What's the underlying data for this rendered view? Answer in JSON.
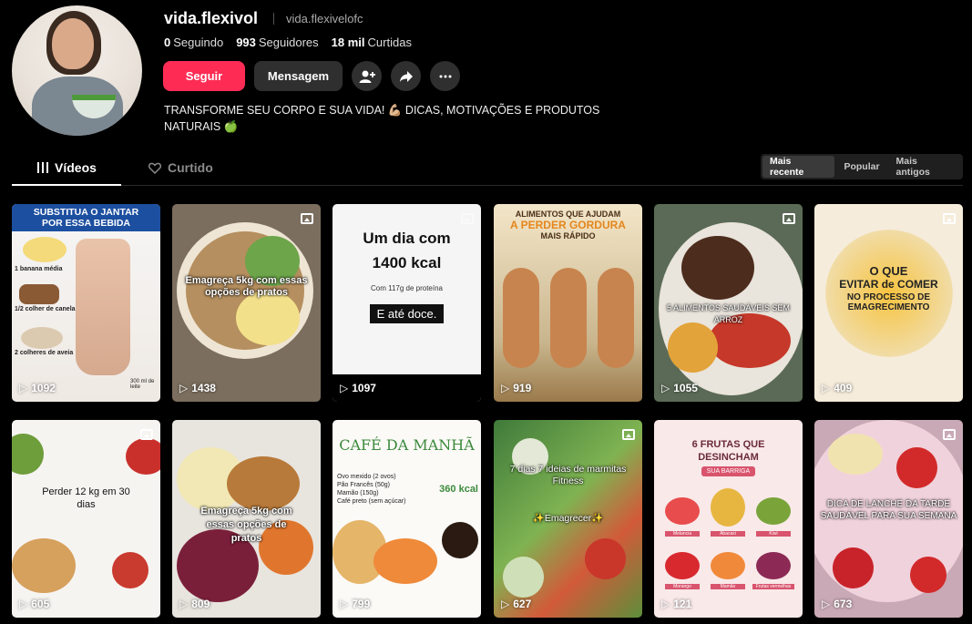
{
  "profile": {
    "username": "vida.flexivol",
    "handle": "vida.flexivelofc",
    "stats": {
      "following_value": "0",
      "following_label": "Seguindo",
      "followers_value": "993",
      "followers_label": "Seguidores",
      "likes_value": "18 mil",
      "likes_label": "Curtidas"
    },
    "follow_label": "Seguir",
    "message_label": "Mensagem",
    "bio_line1": "TRANSFORME SEU CORPO E SUA VIDA! 💪🏼 DICAS, MOTIVAÇÕES E PRODUTOS",
    "bio_line2": "NATURAIS 🍏"
  },
  "tabs": {
    "videos": "Vídeos",
    "liked": "Curtido"
  },
  "sort": {
    "recent": "Mais recente",
    "popular": "Popular",
    "oldest": "Mais antigos"
  },
  "videos": [
    {
      "views": "1092",
      "title": "SUBSTITUA O JANTAR POR ESSA BEBIDA",
      "l1": "1 banana média",
      "l2": "1/2 colher de canela",
      "l3": "2 colheres de aveia",
      "l4": "300 ml de leite"
    },
    {
      "views": "1438",
      "caption": "Emagreça 5kg com essas opções de pratos"
    },
    {
      "views": "1097",
      "title": "Um dia com 1400 kcal",
      "sub": "Com 117g de proteína",
      "tag": "E até doce."
    },
    {
      "views": "919",
      "title1": "ALIMENTOS QUE AJUDAM",
      "title2": "A PERDER GORDURA",
      "title3": "MAIS RÁPIDO"
    },
    {
      "views": "1055",
      "caption": "5 ALIMENTOS SAUDÁVEIS SEM ARROZ"
    },
    {
      "views": "409",
      "t1": "O QUE",
      "t2": "EVITAR de COMER",
      "t3": "NO PROCESSO DE",
      "t4": "EMAGRECIMENTO"
    },
    {
      "views": "605",
      "caption": "Perder 12 kg em 30 dias"
    },
    {
      "views": "809",
      "caption": "Emagreça 5kg com essas opções de pratos"
    },
    {
      "views": "799",
      "title": "CAFÉ DA MANHÃ",
      "i1": "Ovo mexido (2 ovos)",
      "i2": "Pão Francês (50g)",
      "i3": "Mamão (150g)",
      "i4": "Café preto (sem açúcar)",
      "kcal": "360 kcal"
    },
    {
      "views": "627",
      "caption": "7 dias 7 ideias de marmitas Fitness",
      "tag": "✨Emagrecer✨"
    },
    {
      "views": "121",
      "title": "6 FRUTAS QUE DESINCHAM",
      "badge": "SUA BARRIGA",
      "f1": "Melancia",
      "f2": "Abacaxi",
      "f3": "Kiwi",
      "f4": "Morango",
      "f5": "Mamão",
      "f6": "Frutas vermelhas"
    },
    {
      "views": "673",
      "caption": "DICA DE LANCHE DA TARDE SAUDÁVEL PARA SUA SEMANA"
    }
  ],
  "colors": {
    "accent": "#fe2c55",
    "button": "#2f2f2f",
    "background": "#000000"
  }
}
